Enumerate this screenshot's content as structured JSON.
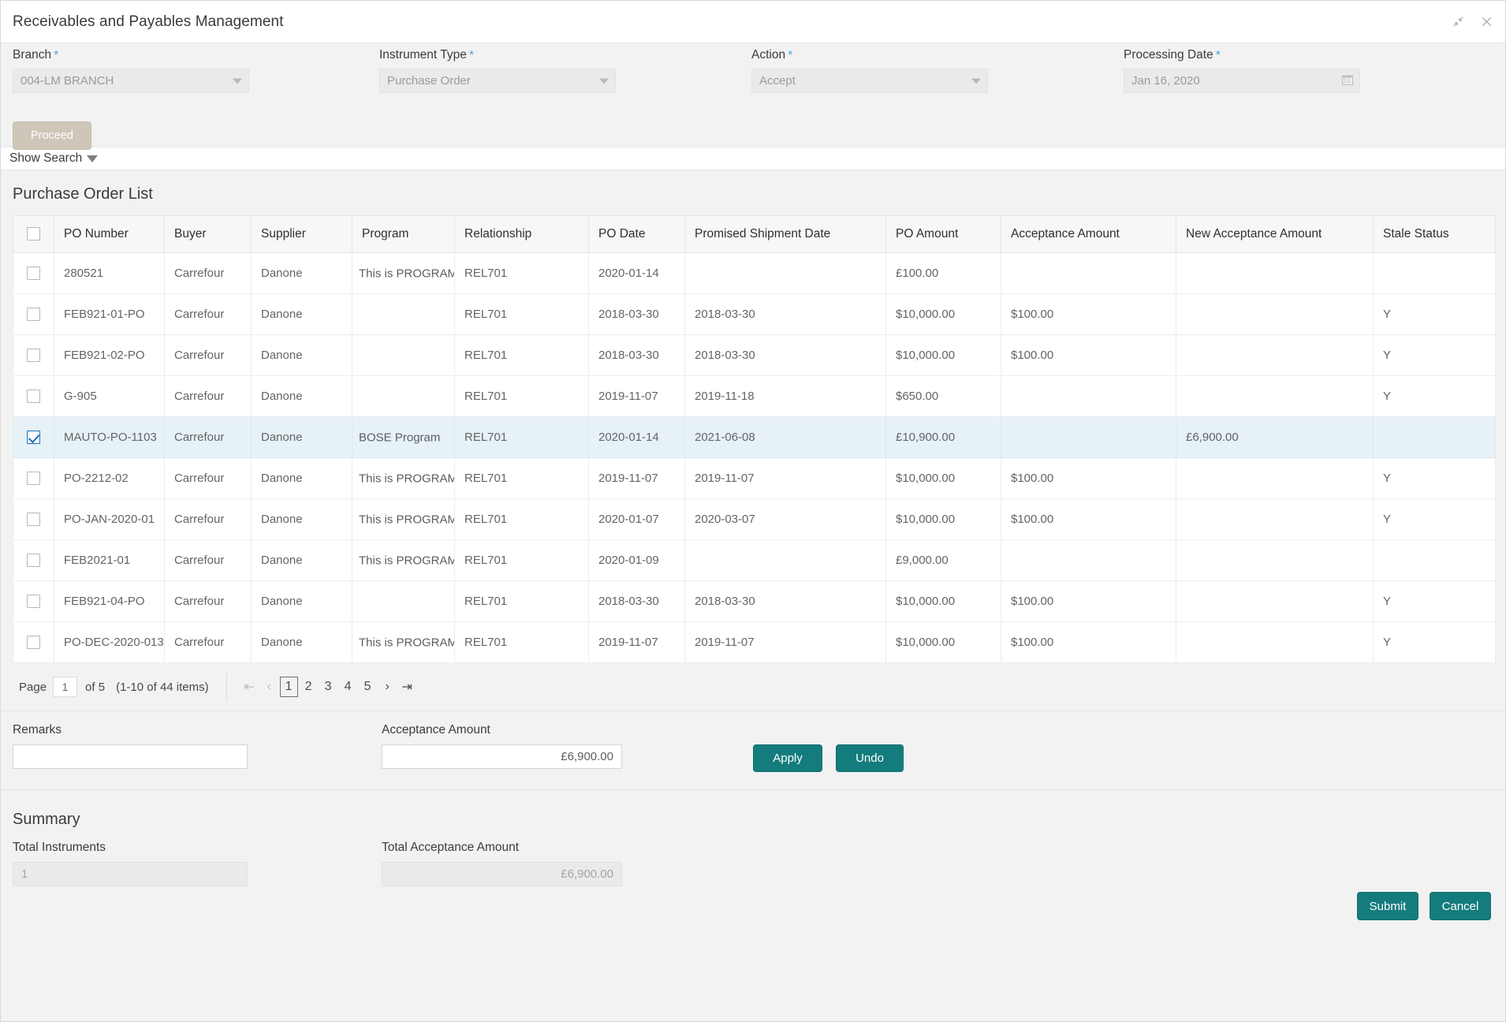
{
  "window": {
    "title": "Receivables and Payables Management",
    "minimize_icon": "collapse-icon",
    "close_icon": "close-icon"
  },
  "filters": {
    "branch": {
      "label": "Branch",
      "required": "*",
      "value": "004-LM BRANCH"
    },
    "instrument_type": {
      "label": "Instrument Type",
      "required": "*",
      "value": "Purchase Order"
    },
    "action": {
      "label": "Action",
      "required": "*",
      "value": "Accept"
    },
    "processing_date": {
      "label": "Processing Date",
      "required": "*",
      "value": "Jan 16, 2020",
      "icon": "calendar-icon"
    },
    "proceed_label": "Proceed"
  },
  "search": {
    "show_search_label": "Show Search",
    "caret_icon": "chevron-down-icon"
  },
  "list": {
    "title": "Purchase Order List",
    "columns": [
      "",
      "PO Number",
      "Buyer",
      "Supplier",
      "Program",
      "Relationship",
      "PO Date",
      "Promised Shipment Date",
      "PO Amount",
      "Acceptance Amount",
      "New Acceptance Amount",
      "Stale Status"
    ],
    "rows": [
      {
        "selected": false,
        "po_number": "280521",
        "buyer": "Carrefour",
        "supplier": "Danone",
        "program": "This is PROGRAM",
        "relationship": "REL701",
        "po_date": "2020-01-14",
        "promised_shipment_date": "",
        "po_amount": "£100.00",
        "acceptance_amount": "",
        "new_acceptance_amount": "",
        "stale_status": ""
      },
      {
        "selected": false,
        "po_number": "FEB921-01-PO",
        "buyer": "Carrefour",
        "supplier": "Danone",
        "program": "",
        "relationship": "REL701",
        "po_date": "2018-03-30",
        "promised_shipment_date": "2018-03-30",
        "po_amount": "$10,000.00",
        "acceptance_amount": "$100.00",
        "new_acceptance_amount": "",
        "stale_status": "Y"
      },
      {
        "selected": false,
        "po_number": "FEB921-02-PO",
        "buyer": "Carrefour",
        "supplier": "Danone",
        "program": "",
        "relationship": "REL701",
        "po_date": "2018-03-30",
        "promised_shipment_date": "2018-03-30",
        "po_amount": "$10,000.00",
        "acceptance_amount": "$100.00",
        "new_acceptance_amount": "",
        "stale_status": "Y"
      },
      {
        "selected": false,
        "po_number": "G-905",
        "buyer": "Carrefour",
        "supplier": "Danone",
        "program": "",
        "relationship": "REL701",
        "po_date": "2019-11-07",
        "promised_shipment_date": "2019-11-18",
        "po_amount": "$650.00",
        "acceptance_amount": "",
        "new_acceptance_amount": "",
        "stale_status": "Y"
      },
      {
        "selected": true,
        "po_number": "MAUTO-PO-1103",
        "buyer": "Carrefour",
        "supplier": "Danone",
        "program": "BOSE Program",
        "relationship": "REL701",
        "po_date": "2020-01-14",
        "promised_shipment_date": "2021-06-08",
        "po_amount": "£10,900.00",
        "acceptance_amount": "",
        "new_acceptance_amount": "£6,900.00",
        "stale_status": ""
      },
      {
        "selected": false,
        "po_number": "PO-2212-02",
        "buyer": "Carrefour",
        "supplier": "Danone",
        "program": "This is PROGRAM",
        "relationship": "REL701",
        "po_date": "2019-11-07",
        "promised_shipment_date": "2019-11-07",
        "po_amount": "$10,000.00",
        "acceptance_amount": "$100.00",
        "new_acceptance_amount": "",
        "stale_status": "Y"
      },
      {
        "selected": false,
        "po_number": "PO-JAN-2020-01",
        "buyer": "Carrefour",
        "supplier": "Danone",
        "program": "This is PROGRAM",
        "relationship": "REL701",
        "po_date": "2020-01-07",
        "promised_shipment_date": "2020-03-07",
        "po_amount": "$10,000.00",
        "acceptance_amount": "$100.00",
        "new_acceptance_amount": "",
        "stale_status": "Y"
      },
      {
        "selected": false,
        "po_number": "FEB2021-01",
        "buyer": "Carrefour",
        "supplier": "Danone",
        "program": "This is PROGRAM",
        "relationship": "REL701",
        "po_date": "2020-01-09",
        "promised_shipment_date": "",
        "po_amount": "£9,000.00",
        "acceptance_amount": "",
        "new_acceptance_amount": "",
        "stale_status": ""
      },
      {
        "selected": false,
        "po_number": "FEB921-04-PO",
        "buyer": "Carrefour",
        "supplier": "Danone",
        "program": "",
        "relationship": "REL701",
        "po_date": "2018-03-30",
        "promised_shipment_date": "2018-03-30",
        "po_amount": "$10,000.00",
        "acceptance_amount": "$100.00",
        "new_acceptance_amount": "",
        "stale_status": "Y"
      },
      {
        "selected": false,
        "po_number": "PO-DEC-2020-013",
        "buyer": "Carrefour",
        "supplier": "Danone",
        "program": "This is PROGRAM",
        "relationship": "REL701",
        "po_date": "2019-11-07",
        "promised_shipment_date": "2019-11-07",
        "po_amount": "$10,000.00",
        "acceptance_amount": "$100.00",
        "new_acceptance_amount": "",
        "stale_status": "Y"
      }
    ]
  },
  "pagination": {
    "page_label": "Page",
    "page_value": "1",
    "of_label": "of 5",
    "items_label": "(1-10 of 44 items)",
    "first_icon": "first-page-icon",
    "prev_icon": "previous-page-icon",
    "next_icon": "next-page-icon",
    "last_icon": "last-page-icon",
    "pages": [
      "1",
      "2",
      "3",
      "4",
      "5"
    ],
    "current_page": "1"
  },
  "remarks_section": {
    "remarks_label": "Remarks",
    "remarks_value": "",
    "acceptance_label": "Acceptance Amount",
    "acceptance_value": "£6,900.00",
    "apply_label": "Apply",
    "undo_label": "Undo"
  },
  "summary": {
    "title": "Summary",
    "total_instruments_label": "Total Instruments",
    "total_instruments_value": "1",
    "total_acceptance_label": "Total Acceptance Amount",
    "total_acceptance_value": "£6,900.00"
  },
  "footer": {
    "submit_label": "Submit",
    "cancel_label": "Cancel"
  },
  "colors": {
    "accent_teal": "#147c7c",
    "selected_row": "#e6f2f8",
    "required_star": "#4aa8e0",
    "proceed_disabled": "#cdc6b9"
  }
}
